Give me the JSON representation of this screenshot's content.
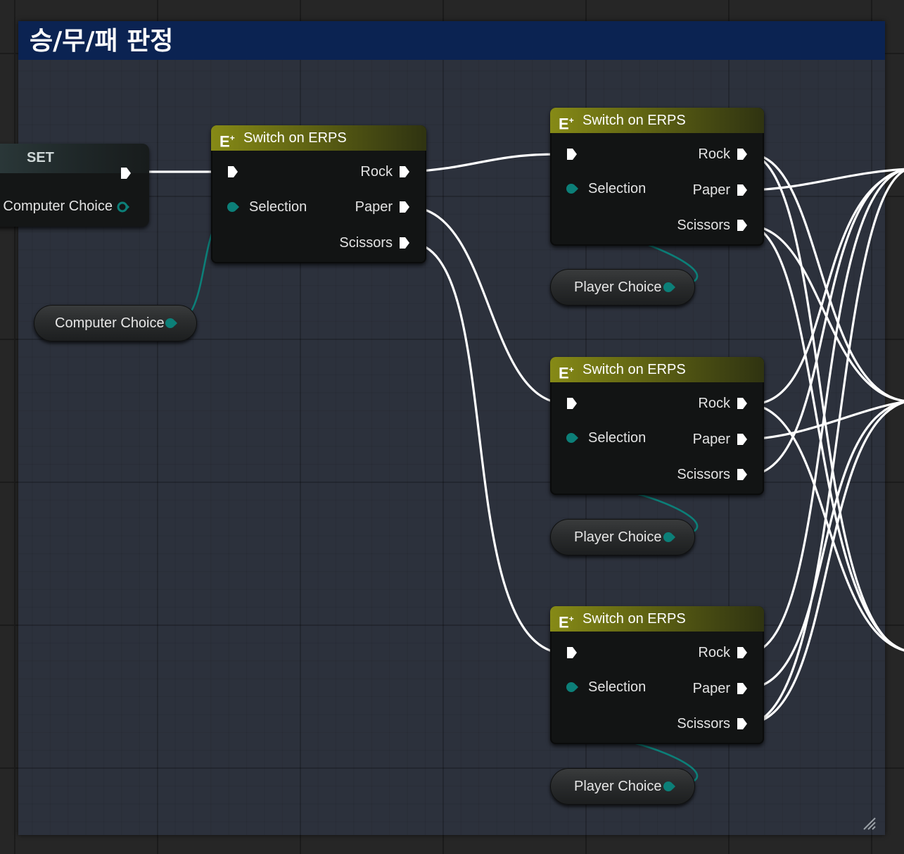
{
  "comment": {
    "title": "승/무/패 판정"
  },
  "set_node": {
    "title": "SET",
    "pin_label": "Computer Choice"
  },
  "computer_choice_var": {
    "label": "Computer Choice"
  },
  "switch_nodes": [
    {
      "title": "Switch on ERPS",
      "selection": "Selection",
      "outputs": [
        "Rock",
        "Paper",
        "Scissors"
      ]
    },
    {
      "title": "Switch on ERPS",
      "selection": "Selection",
      "outputs": [
        "Rock",
        "Paper",
        "Scissors"
      ]
    },
    {
      "title": "Switch on ERPS",
      "selection": "Selection",
      "outputs": [
        "Rock",
        "Paper",
        "Scissors"
      ]
    },
    {
      "title": "Switch on ERPS",
      "selection": "Selection",
      "outputs": [
        "Rock",
        "Paper",
        "Scissors"
      ]
    }
  ],
  "player_choice_vars": [
    {
      "label": "Player Choice"
    },
    {
      "label": "Player Choice"
    },
    {
      "label": "Player Choice"
    }
  ],
  "colors": {
    "comment_header": "#0b2352",
    "switch_header": "#868a16",
    "enum_pin": "#0c7f78",
    "exec_wire": "#ffffff"
  },
  "icons": {
    "switch_header": "enum-switch-icon",
    "exec": "exec-pin-icon",
    "data": "enum-pin-icon"
  }
}
